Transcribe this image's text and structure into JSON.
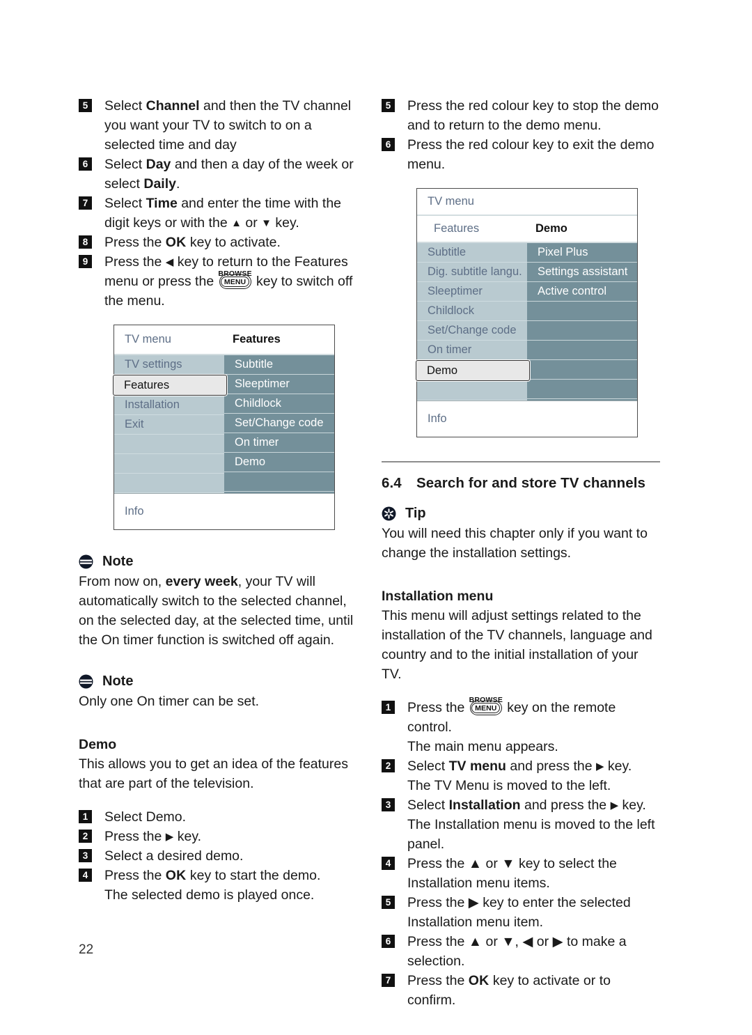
{
  "page": {
    "number": "22"
  },
  "left_column": {
    "steps_top": [
      {
        "num": "5",
        "html": "Select <b>Channel</b> and then the TV channel you want your TV to switch to on a selected time and day"
      },
      {
        "num": "6",
        "html": "Select <b>Day</b> and then a day of the week or select <b>Daily</b>."
      },
      {
        "num": "7",
        "html": "Select <b>Time</b> and enter the time with the digit keys or with the ▲ or ▼ key."
      },
      {
        "num": "8",
        "html": "Press the <b>OK</b> key to activate."
      },
      {
        "num": "9",
        "html": "Press the ◀ key to return to the Features menu or press the [MENU] key to switch off the menu."
      }
    ],
    "step9_part1": "Press the ",
    "step9_part2": " key to return to the Features menu or press the ",
    "step9_part3": " key to switch off the menu.",
    "menu": {
      "header_left": "TV menu",
      "header_right": "Features",
      "left_items": [
        "TV settings",
        "Features",
        "Installation",
        "Exit"
      ],
      "left_selected": "Features",
      "right_items": [
        "Subtitle",
        "Sleeptimer",
        "Childlock",
        "Set/Change code",
        "On timer",
        "Demo"
      ],
      "footer": "Info"
    },
    "note1": {
      "title": "Note",
      "icon": "note-icon",
      "body_pre": "From now on, ",
      "body_bold": "every week",
      "body_post": ", your TV will automatically switch to the selected channel, on the selected day, at the selected time, until the On timer function is switched off again."
    },
    "note2": {
      "title": "Note",
      "icon": "note-icon",
      "body": "Only one On timer can be set."
    },
    "demo": {
      "heading": "Demo",
      "body": "This allows you to get an idea of the features that are part of the television.",
      "steps": [
        {
          "num": "1",
          "text": "Select Demo."
        },
        {
          "num": "2",
          "text": "Press the ▶ key."
        },
        {
          "num": "3",
          "text": "Select a desired demo."
        },
        {
          "num": "4",
          "text": "Press the OK key to start the demo."
        }
      ],
      "step2_pre": "Press the ",
      "step2_post": " key.",
      "step4_pre": "Press the ",
      "step4_ok": "OK",
      "step4_post": " key to start the demo.",
      "step4_sub": "The selected demo is played once."
    }
  },
  "right_column": {
    "steps_top": [
      {
        "num": "5",
        "text": "Press the red colour key to stop the demo and to return to the demo menu."
      },
      {
        "num": "6",
        "text": "Press the red colour key to exit the demo menu."
      }
    ],
    "menu": {
      "header_top": "TV menu",
      "header_left": "Features",
      "header_right": "Demo",
      "left_items": [
        "Subtitle",
        "Dig. subtitle langu.",
        "Sleeptimer",
        "Childlock",
        "Set/Change code",
        "On timer",
        "Demo"
      ],
      "left_selected": "Demo",
      "right_items": [
        "Pixel Plus",
        "Settings assistant",
        "Active control"
      ],
      "footer": "Info"
    },
    "section": {
      "number": "6.4",
      "title": "Search for and store TV channels"
    },
    "tip": {
      "title": "Tip",
      "icon": "tip-icon",
      "body": "You will need this chapter only if you want to change the installation settings."
    },
    "installation": {
      "heading": "Installation menu",
      "body": "This menu will adjust settings related to the installation of the TV channels, language and country and to the initial installation of your TV.",
      "steps": [
        {
          "num": "1",
          "pre": "Press the ",
          "post": " key on the remote control.",
          "sub": "The main menu appears."
        },
        {
          "num": "2",
          "pre": "Select ",
          "bold": "TV menu",
          "mid": " and press the ",
          "arrow": "▶",
          "post": " key.",
          "sub": "The TV Menu is moved to the left."
        },
        {
          "num": "3",
          "pre": "Select ",
          "bold": "Installation",
          "mid": " and press the ",
          "arrow": "▶",
          "post": " key.",
          "sub": "The Installation menu is moved to the left panel."
        },
        {
          "num": "4",
          "text": "Press the ▲ or ▼ key to select the",
          "sub": "Installation menu items."
        },
        {
          "num": "5",
          "text": "Press the ▶ key to enter the selected",
          "sub": "Installation menu item."
        },
        {
          "num": "6",
          "text": "Press the ▲ or ▼, ◀ or ▶ to make a",
          "sub": "selection."
        },
        {
          "num": "7",
          "pre": "Press the ",
          "ok": "OK",
          "post": " key to activate or to confirm."
        }
      ]
    },
    "menukey_label": {
      "browse": "BROWSE",
      "menu": "MENU"
    }
  },
  "colors": {
    "menu_left_panel": "#b9cad0",
    "menu_right_panel": "#74909a",
    "menu_left_text": "#5d6e86",
    "menu_selected_bg": "#e8e8e8",
    "rule": "#8d8d8d"
  }
}
